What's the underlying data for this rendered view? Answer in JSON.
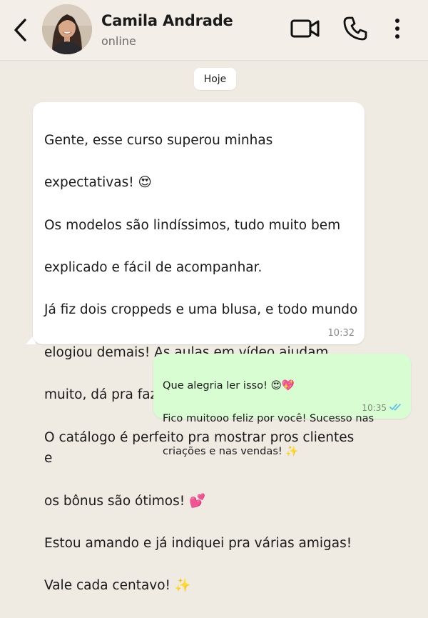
{
  "header": {
    "contact_name": "Camila Andrade",
    "status": "online",
    "icons": [
      "back-arrow-icon",
      "video-call-icon",
      "phone-icon",
      "more-vertical-icon"
    ]
  },
  "chat": {
    "date_chip": "Hoje",
    "incoming": {
      "lines": [
        "Gente, esse curso superou minhas",
        "expectativas! 😍",
        "Os modelos são lindíssimos, tudo muito bem",
        "explicado e fácil de acompanhar.",
        "Já fiz dois croppeds e uma blusa, e todo mundo",
        "elogiou demais! As aulas em vídeo ajudam",
        "muito, dá pra fazer no seu tempo.",
        "O catálogo é perfeito pra mostrar pros clientes e",
        "os bônus são ótimos! 💕",
        "Estou amando e já indiquei pra várias amigas!",
        "Vale cada centavo! ✨"
      ],
      "time": "10:32"
    },
    "outgoing": {
      "lines": [
        "Que alegria ler isso! 😍💖",
        "Fico muitooo feliz por você! Sucesso nas",
        "criações e nas vendas! ✨"
      ],
      "time": "10:35",
      "read_status": "read"
    }
  },
  "colors": {
    "background": "#efeae2",
    "incoming_bubble": "#ffffff",
    "outgoing_bubble": "#d9fdd3",
    "read_ticks": "#53bdeb"
  }
}
